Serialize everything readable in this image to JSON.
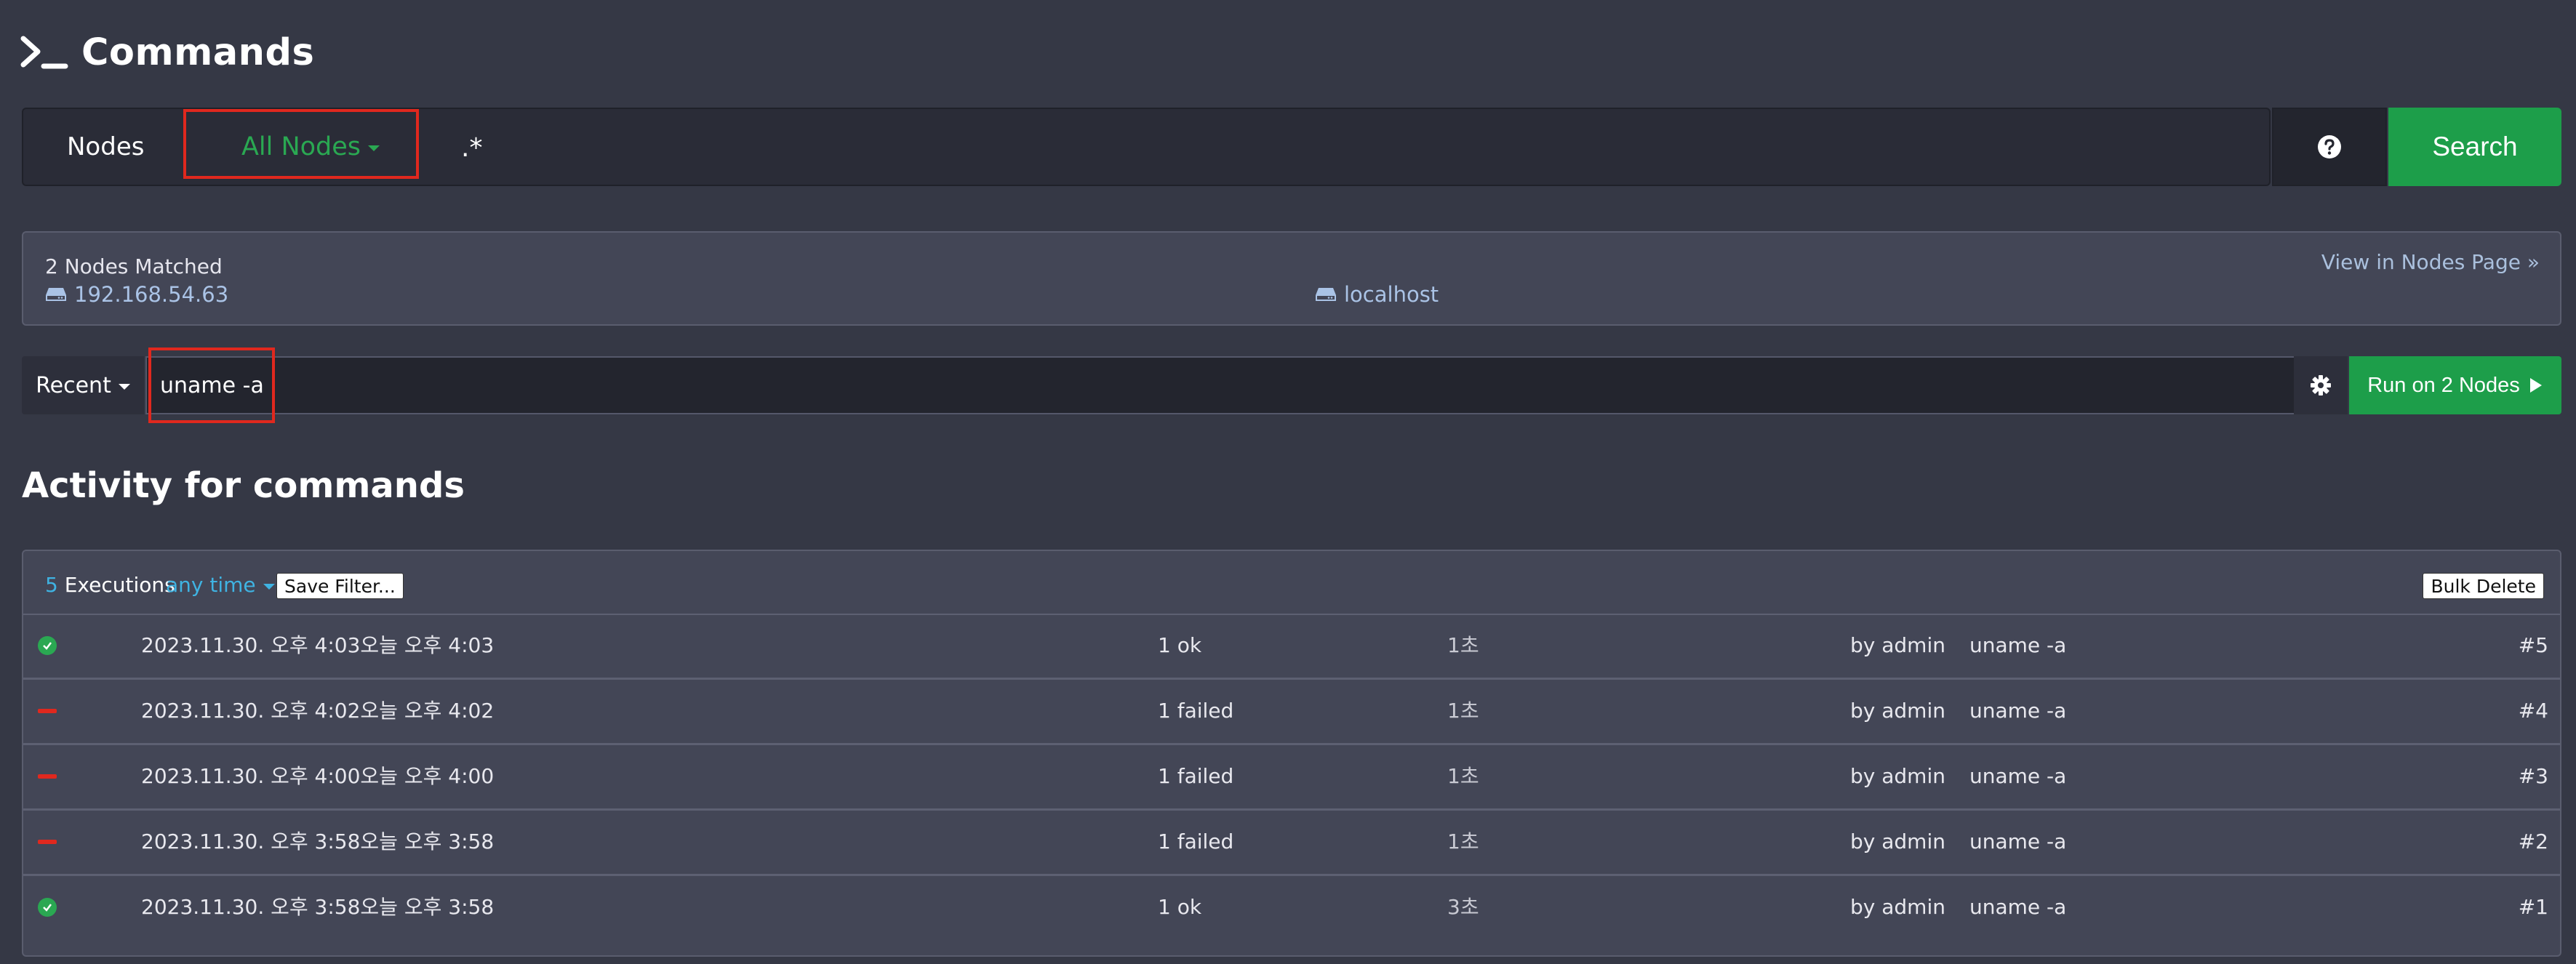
{
  "header": {
    "title": "Commands"
  },
  "node_filter": {
    "label": "Nodes",
    "dropdown_label": "All Nodes",
    "filter_value": ".*",
    "search_label": "Search"
  },
  "matched": {
    "count_text": "2 Nodes Matched",
    "view_link": "View in Nodes Page »",
    "nodes": [
      "192.168.54.63",
      "localhost"
    ]
  },
  "command_bar": {
    "recent_label": "Recent",
    "command_value": "uname -a",
    "run_label": "Run on 2 Nodes"
  },
  "activity": {
    "heading": "Activity for commands",
    "exec_count": "5",
    "exec_label": "Executions",
    "time_filter": "any time",
    "save_filter_label": "Save Filter...",
    "bulk_delete_label": "Bulk Delete",
    "rows": [
      {
        "status": "ok",
        "date": "2023.11.30. 오후 4:03",
        "relative": "오늘 오후 4:03",
        "result": "1 ok",
        "duration": "1초",
        "user": "by admin",
        "command": "uname -a",
        "id": "#5"
      },
      {
        "status": "failed",
        "date": "2023.11.30. 오후 4:02",
        "relative": "오늘 오후 4:02",
        "result": "1 failed",
        "duration": "1초",
        "user": "by admin",
        "command": "uname -a",
        "id": "#4"
      },
      {
        "status": "failed",
        "date": "2023.11.30. 오후 4:00",
        "relative": "오늘 오후 4:00",
        "result": "1 failed",
        "duration": "1초",
        "user": "by admin",
        "command": "uname -a",
        "id": "#3"
      },
      {
        "status": "failed",
        "date": "2023.11.30. 오후 3:58",
        "relative": "오늘 오후 3:58",
        "result": "1 failed",
        "duration": "1초",
        "user": "by admin",
        "command": "uname -a",
        "id": "#2"
      },
      {
        "status": "ok",
        "date": "2023.11.30. 오후 3:58",
        "relative": "오늘 오후 3:58",
        "result": "1 ok",
        "duration": "3초",
        "user": "by admin",
        "command": "uname -a",
        "id": "#1"
      }
    ]
  },
  "colors": {
    "background": "#353845",
    "accent_green": "#1d9e4a",
    "link_blue": "#3fb3e2",
    "status_ok": "#2aa852",
    "status_failed": "#e0281e",
    "highlight_box": "#e0281e"
  },
  "icons": {
    "title": "terminal-prompt-icon",
    "help": "question-circle-icon",
    "settings": "gear-icon",
    "run": "play-icon",
    "node": "server-icon",
    "ok": "check-circle-icon",
    "failed": "minus-icon"
  }
}
